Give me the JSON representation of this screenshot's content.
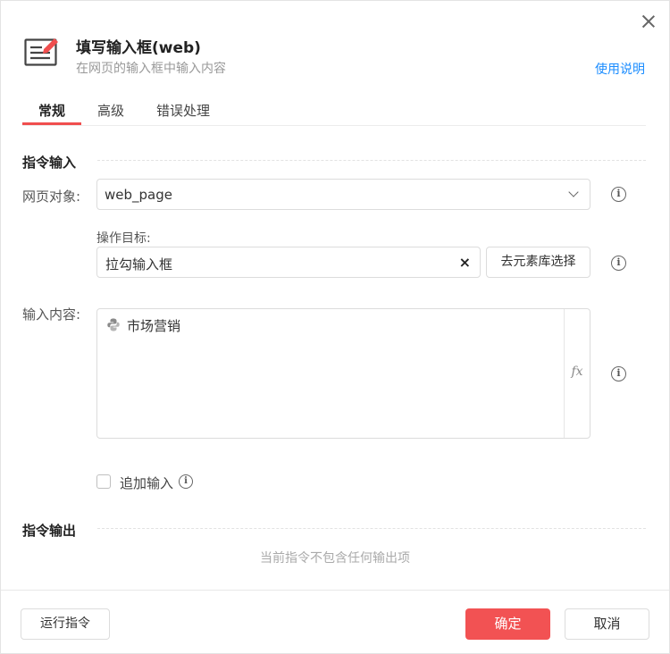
{
  "header": {
    "title": "填写输入框(web)",
    "subtitle": "在网页的输入框中输入内容",
    "help_link": "使用说明",
    "icon": "edit-document-icon"
  },
  "tabs": [
    {
      "label": "常规",
      "active": true
    },
    {
      "label": "高级",
      "active": false
    },
    {
      "label": "错误处理",
      "active": false
    }
  ],
  "input_section": {
    "title": "指令输入",
    "web_object": {
      "label": "网页对象:",
      "value": "web_page"
    },
    "target": {
      "label": "操作目标:",
      "value": "拉勾输入框",
      "clear_icon": "×",
      "pick_button": "去元素库选择"
    },
    "content": {
      "label": "输入内容:",
      "token_text": "市场营销",
      "token_icon": "python-icon",
      "fx_label": "fx"
    },
    "append": {
      "label": "追加输入",
      "checked": false
    }
  },
  "output_section": {
    "title": "指令输出",
    "empty_hint": "当前指令不包含任何输出项"
  },
  "footer": {
    "run_button": "运行指令",
    "ok_button": "确定",
    "cancel_button": "取消"
  },
  "colors": {
    "accent": "#f25253",
    "link": "#1a8cff",
    "tab_underline": "#f04e4e"
  }
}
